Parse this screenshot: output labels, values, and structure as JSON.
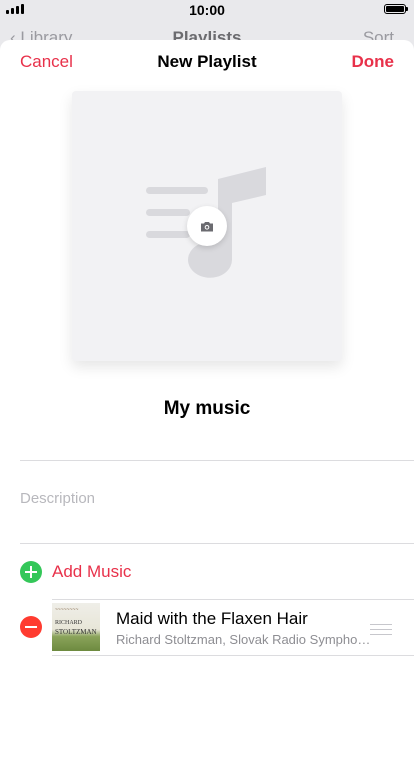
{
  "status_bar": {
    "time": "10:00"
  },
  "background_nav": {
    "back_label": "Library",
    "title": "Playlists",
    "sort_label": "Sort"
  },
  "nav": {
    "cancel_label": "Cancel",
    "title": "New Playlist",
    "done_label": "Done"
  },
  "artwork": {
    "placeholder_icon": "music-note-icon",
    "camera_icon": "camera-icon"
  },
  "playlist_name": "My music",
  "description": {
    "placeholder": "Description"
  },
  "add_music": {
    "icon": "plus-circle-icon",
    "label": "Add Music"
  },
  "songs": [
    {
      "title": "Maid with the Flaxen Hair",
      "artist": "Richard Stoltzman, Slovak Radio Symphony Orchestra",
      "art": {
        "line1": "RICHARD",
        "line2": "STOLTZMAN"
      }
    }
  ],
  "colors": {
    "accent": "#e8314a",
    "add": "#34c759",
    "remove": "#ff3b30"
  }
}
